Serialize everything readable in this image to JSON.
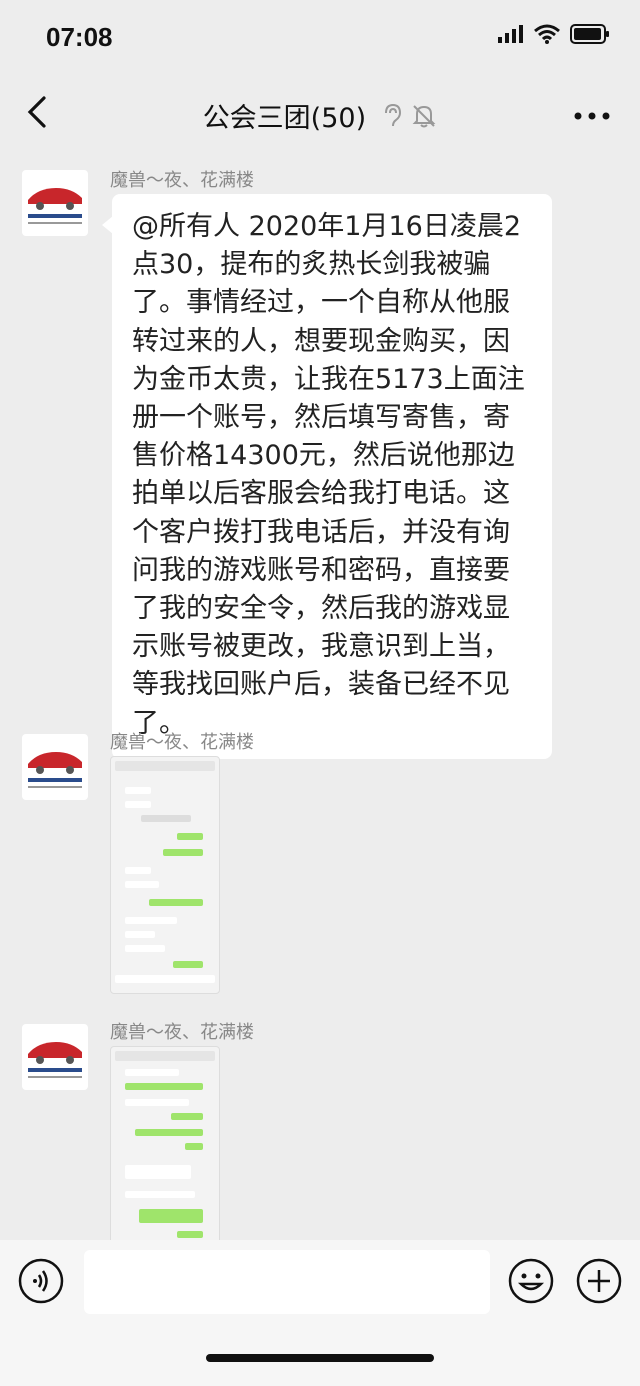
{
  "status": {
    "time": "07:08"
  },
  "header": {
    "back_icon": "chevron-left-icon",
    "title": "公会三团(50)",
    "ear_icon": "ear-icon",
    "mute_icon": "bell-muted-icon",
    "more_icon": "more-icon"
  },
  "messages": [
    {
      "sender": "魔兽～夜、花满楼",
      "type": "text",
      "lines": [
        "@所有人 2020年1月16日凌晨2",
        "点30，提布的炙热长剑我被骗",
        "了。事情经过，一个自称从他服",
        "转过来的人，想要现金购买，因",
        "为金币太贵，让我在5173上面注",
        "册一个账号，然后填写寄售，寄",
        "售价格14300元，然后说他那边",
        "拍单以后客服会给我打电话。这",
        "个客户拨打我电话后，并没有询",
        "问我的游戏账号和密码，直接要",
        "了我的安全令，然后我的游戏显",
        "示账号被更改，我意识到上当，",
        "等我找回账户后，装备已经不见",
        "了。"
      ]
    },
    {
      "sender": "魔兽～夜、花满楼",
      "type": "image",
      "image_desc": "chat-screenshot"
    },
    {
      "sender": "魔兽～夜、花满楼",
      "type": "image",
      "image_desc": "chat-screenshot"
    }
  ],
  "input_bar": {
    "voice_icon": "voice-icon",
    "emoji_icon": "emoji-icon",
    "plus_icon": "plus-icon"
  }
}
